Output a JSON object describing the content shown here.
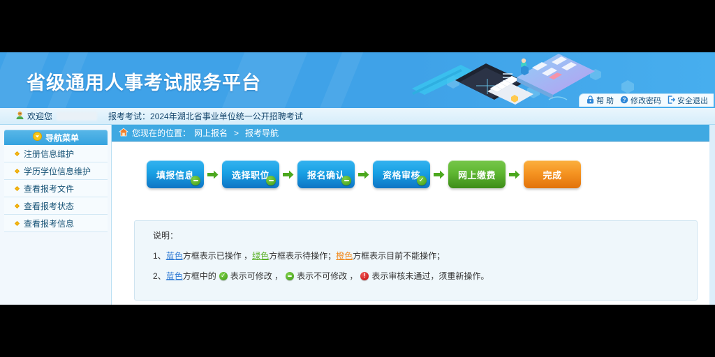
{
  "banner": {
    "title": "省级通用人事考试服务平台",
    "quicklinks": [
      {
        "label": "帮 助",
        "icon": "lock-icon"
      },
      {
        "label": "修改密码",
        "icon": "question-circle-icon"
      },
      {
        "label": "安全退出",
        "icon": "logout-icon"
      }
    ]
  },
  "welcome": {
    "icon": "user-avatar-icon",
    "greeting": "欢迎您",
    "username_redacted": "",
    "exam_label": "报考考试：2024年湖北省事业单位统一公开招聘考试"
  },
  "sidebar": {
    "header": {
      "label": "导航菜单",
      "icon": "chevron-down-circle-icon"
    },
    "items": [
      {
        "label": "注册信息维护"
      },
      {
        "label": "学历学位信息维护"
      },
      {
        "label": "查看报考文件"
      },
      {
        "label": "查看报考状态"
      },
      {
        "label": "查看报考信息"
      }
    ]
  },
  "breadcrumb": {
    "icon": "home-icon",
    "prefix": "您现在的位置：",
    "parent": "网上报名",
    "separator": ">",
    "current": "报考导航"
  },
  "steps": [
    {
      "label": "填报信息",
      "state": "blue",
      "badge": "minus"
    },
    {
      "label": "选择职位",
      "state": "blue",
      "badge": "minus"
    },
    {
      "label": "报名确认",
      "state": "blue",
      "badge": "minus"
    },
    {
      "label": "资格审核",
      "state": "blue",
      "badge": "check"
    },
    {
      "label": "网上缴费",
      "state": "green",
      "badge": "none"
    },
    {
      "label": "完成",
      "state": "orange",
      "badge": "none"
    }
  ],
  "info": {
    "title": "说明：",
    "line1": {
      "num": "1、",
      "kw1": "蓝色",
      "t1": "方框表示已操作 ，",
      "kw2": "绿色",
      "t2": "方框表示待操作；",
      "kw3": "橙色",
      "t3": "方框表示目前不能操作；"
    },
    "line2": {
      "num": "2、",
      "kw1": "蓝色",
      "t1": "方框中的",
      "t2": "表示可修改 ，",
      "t3": "表示不可修改 ，",
      "t4": "表示审核未通过，须重新操作。"
    }
  },
  "colors": {
    "brand_blue": "#3fa2e8",
    "step_blue": "#18a0e4",
    "step_green": "#5fb732",
    "step_orange": "#f59422",
    "accent_yellow": "#f5b917",
    "link_blue": "#2f7bd4",
    "link_green": "#56ae22",
    "link_orange": "#f08b20",
    "alert_red": "#c00c0c"
  }
}
